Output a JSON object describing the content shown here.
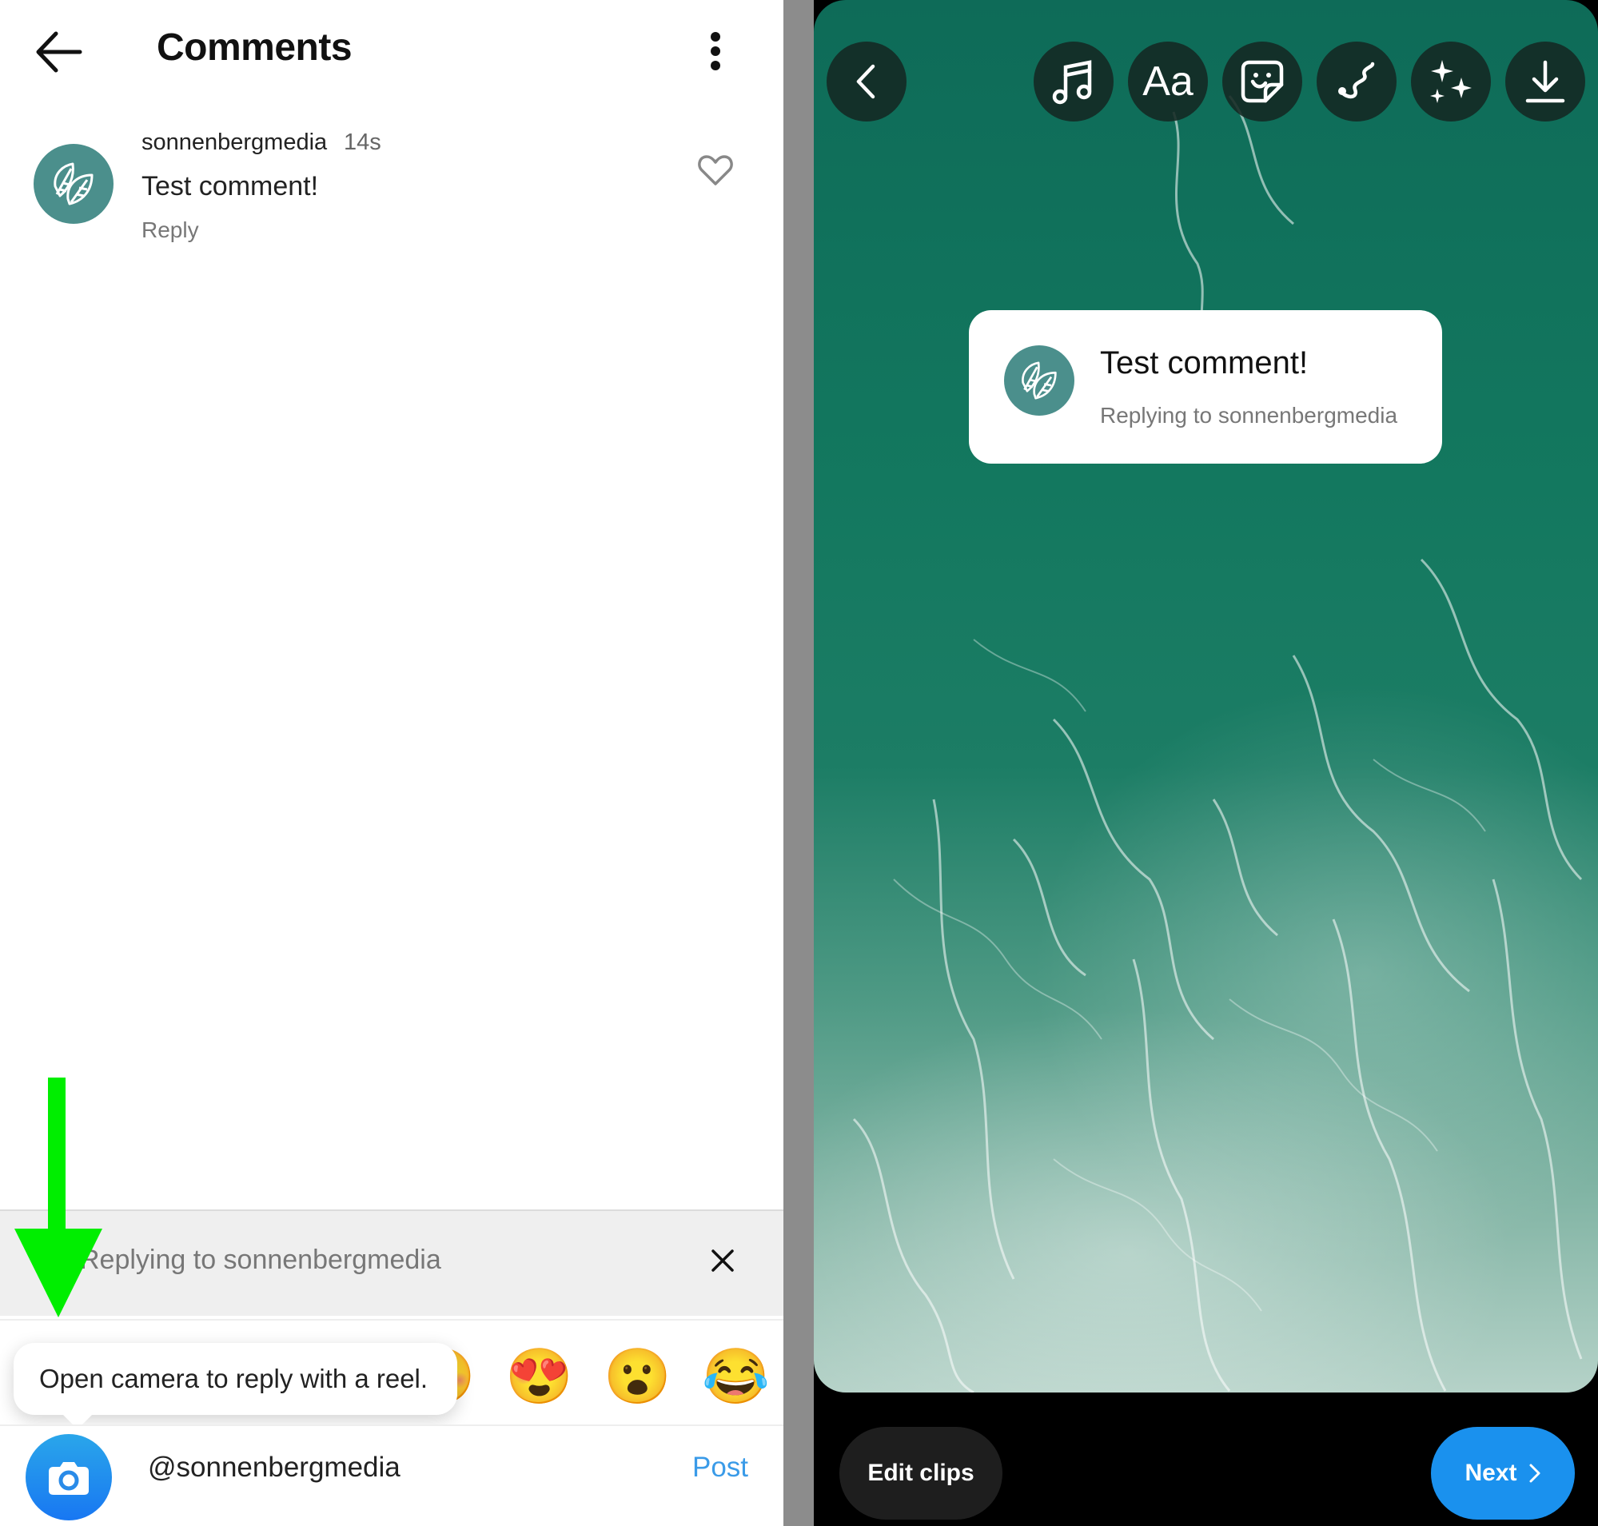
{
  "left": {
    "header": {
      "title": "Comments",
      "back_icon": "arrow-left-icon",
      "more_icon": "more-vertical-icon"
    },
    "comment": {
      "username": "sonnenbergmedia",
      "time": "14s",
      "text": "Test comment!",
      "reply_label": "Reply",
      "like_icon": "heart-outline-icon"
    },
    "reply_bar": {
      "text": "Replying to sonnenbergmedia",
      "close_icon": "close-icon"
    },
    "emojis": [
      "😍",
      "😮",
      "😂"
    ],
    "hidden_emoji": "😊",
    "tooltip": "Open camera to reply with a reel.",
    "input": {
      "value": "@sonnenbergmedia",
      "post_label": "Post",
      "camera_icon": "camera-icon"
    },
    "annotation": {
      "arrow_color": "#00ee00"
    }
  },
  "right": {
    "toolbar": [
      {
        "name": "back",
        "icon": "chevron-left-icon"
      },
      {
        "name": "music",
        "icon": "music-note-icon"
      },
      {
        "name": "text",
        "icon": "text-aa-icon",
        "label": "Aa"
      },
      {
        "name": "sticker",
        "icon": "sticker-icon"
      },
      {
        "name": "draw",
        "icon": "squiggle-draw-icon"
      },
      {
        "name": "effects",
        "icon": "sparkles-icon"
      },
      {
        "name": "download",
        "icon": "download-icon"
      }
    ],
    "sticker": {
      "title": "Test comment!",
      "subtitle": "Replying to sonnenbergmedia"
    },
    "edit_clips_label": "Edit clips",
    "next_label": "Next"
  },
  "colors": {
    "accent_blue": "#1a91ee",
    "post_blue": "#3a9be8",
    "avatar_teal": "#4b8f8c",
    "ocean_green": "#13785f"
  }
}
